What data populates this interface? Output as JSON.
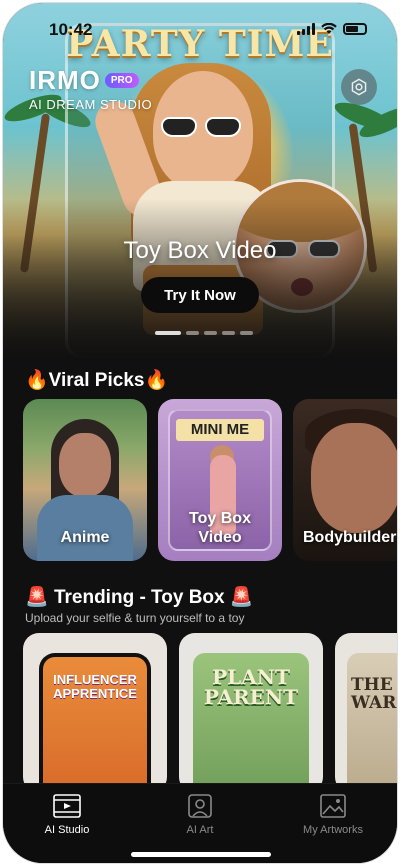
{
  "status_bar": {
    "time": "10:42"
  },
  "hero": {
    "poster_title": "PARTY TIME",
    "title": "Toy Box Video",
    "cta": "Try It Now",
    "pages": 5,
    "active_page": 1
  },
  "brand": {
    "name": "IRMO",
    "badge": "PRO",
    "subtitle": "AI DREAM STUDIO"
  },
  "viral": {
    "title": "Viral Picks",
    "items": [
      {
        "label": "Anime"
      },
      {
        "label": "Toy Box\nVideo",
        "poster_text": "MINI ME"
      },
      {
        "label": "Bodybuilder"
      }
    ]
  },
  "trending": {
    "title": "Trending - Toy Box",
    "subtitle": "Upload your selfie & turn yourself to a toy",
    "items": [
      {
        "poster_text": "INFLUENCER\nAPPRENTICE"
      },
      {
        "poster_text": "PLANT\nPARENT"
      },
      {
        "poster_text": "THE\nWAR"
      }
    ]
  },
  "tabs": [
    {
      "label": "AI Studio",
      "icon": "film-icon",
      "active": true
    },
    {
      "label": "AI Art",
      "icon": "portrait-icon",
      "active": false
    },
    {
      "label": "My Artworks",
      "icon": "gallery-icon",
      "active": false
    }
  ]
}
